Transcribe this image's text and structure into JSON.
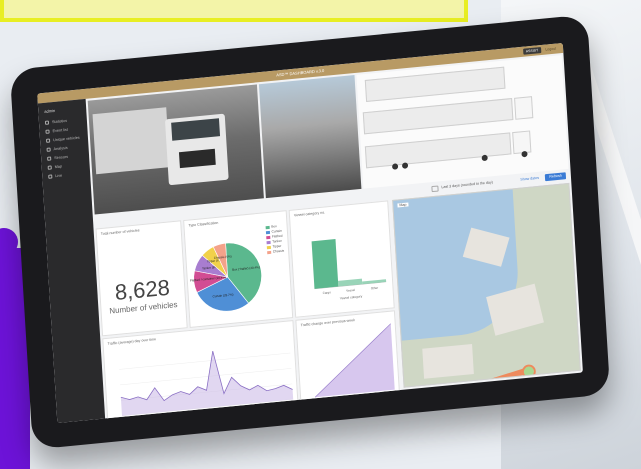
{
  "dashboard": {
    "title": "ASD™ DASHBOARD v.3.0",
    "topbar_button": "ASSIST",
    "topbar_button_2": "Logout"
  },
  "sidebar": {
    "user": "admin",
    "items": [
      {
        "label": "Statistics",
        "icon": "chart-icon"
      },
      {
        "label": "Event list",
        "icon": "list-icon"
      },
      {
        "label": "Unique vehicles",
        "icon": "truck-icon"
      },
      {
        "label": "Analysis",
        "icon": "search-icon"
      },
      {
        "label": "Sensors",
        "icon": "sensor-icon"
      },
      {
        "label": "Map",
        "icon": "map-icon"
      },
      {
        "label": "Live",
        "icon": "live-icon"
      }
    ]
  },
  "filter": {
    "time_range": "Last 3 days (rounded to the day)",
    "show_dates": "Show dates",
    "refresh": "Refresh"
  },
  "panels": {
    "total_vehicles": {
      "title": "Total number of vehicles",
      "value": "8,628",
      "caption": "Number of vehicles"
    },
    "classification": {
      "title": "Type Classification"
    },
    "vessel": {
      "title": "Vessel category no."
    },
    "map": {
      "title": "Map"
    },
    "traffic_day": {
      "title": "Traffic (average) day over time"
    },
    "traffic_avg": {
      "title": "Traffic change over previous week"
    }
  },
  "colors": {
    "topbar": "#b89a64",
    "sidebar": "#2a2a2c",
    "accent": "#3a7bd5",
    "banner_border": "#e8ee23",
    "purple": "#6d13d8"
  },
  "chart_data": [
    {
      "type": "pie",
      "title": "Type Classification",
      "slices": [
        {
          "name": "Box (Trailer) (40.4%)",
          "value": 40.4,
          "color": "#5bb88e"
        },
        {
          "name": "Curtain (28.7%)",
          "value": 28.7,
          "color": "#4f8fd6"
        },
        {
          "name": "Flatbed / container (10.4%)",
          "value": 10.4,
          "color": "#d24d93"
        },
        {
          "name": "Tanker (8%)",
          "value": 8.0,
          "color": "#a87dd0"
        },
        {
          "name": "Tipper (6.5%)",
          "value": 6.5,
          "color": "#f1d14a"
        },
        {
          "name": "Chassis (6%)",
          "value": 6.0,
          "color": "#f4a28a"
        }
      ],
      "legend": [
        "Box",
        "Curtain",
        "Flatbed",
        "Tanker",
        "Tipper",
        "Chassis"
      ]
    },
    {
      "type": "bar",
      "title": "Vessel category no.",
      "categories": [
        "Cargo",
        "Vessel",
        "Other"
      ],
      "values": [
        5200,
        620,
        300
      ],
      "xlabel": "Vessel category",
      "ylim": [
        0,
        7000
      ]
    },
    {
      "type": "area",
      "title": "Traffic (average) day over time",
      "xlabel": "Time (hour)",
      "x": [
        "2024-07-06",
        "2024-07-07",
        "2024-07-08",
        "2024-07-09",
        "2024-07-10",
        "2024-07-11",
        "2024-07-12",
        "2024-07-13"
      ],
      "values": [
        30,
        25,
        28,
        22,
        40,
        18,
        26,
        30,
        24,
        35,
        28,
        90,
        20,
        45,
        30,
        22,
        28,
        18,
        20,
        24,
        16
      ],
      "ylim": [
        0,
        100
      ]
    },
    {
      "type": "area",
      "title": "Traffic change over previous week",
      "xlabel": "Time (hour)",
      "x": [
        "2024-07-06",
        "2024-07-13"
      ],
      "values": [
        0,
        100
      ],
      "ylim": [
        0,
        100
      ]
    }
  ]
}
